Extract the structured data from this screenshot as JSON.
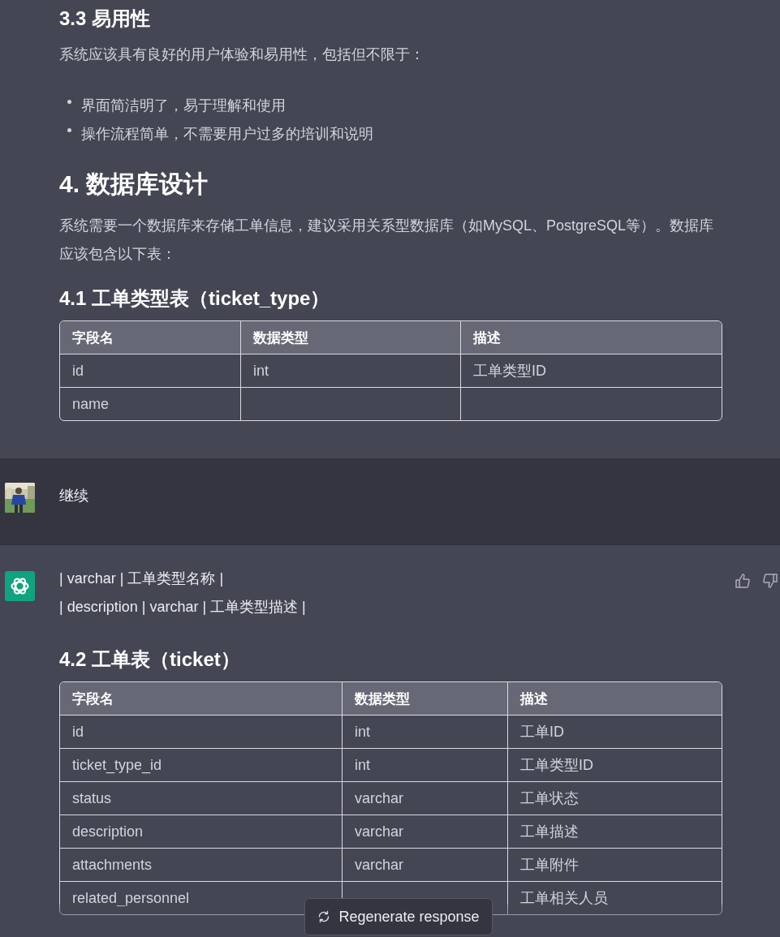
{
  "messages": [
    {
      "kind": "assistant",
      "feedback": false,
      "blocks": [
        {
          "kind": "h3",
          "text": "3.3 易用性"
        },
        {
          "kind": "p",
          "text": "系统应该具有良好的用户体验和易用性，包括但不限于："
        },
        {
          "kind": "ul",
          "items": [
            "界面简洁明了，易于理解和使用",
            "操作流程简单，不需要用户过多的培训和说明"
          ]
        },
        {
          "kind": "h2",
          "text": "4. 数据库设计"
        },
        {
          "kind": "p",
          "text": "系统需要一个数据库来存储工单信息，建议采用关系型数据库（如MySQL、PostgreSQL等）。数据库应该包含以下表："
        },
        {
          "kind": "h3",
          "text": "4.1 工单类型表（ticket_type）"
        },
        {
          "kind": "table",
          "columns": [
            "字段名",
            "数据类型",
            "描述"
          ],
          "rows": [
            [
              "id",
              "int",
              "工单类型ID"
            ],
            [
              "name",
              null,
              null
            ]
          ]
        }
      ]
    },
    {
      "kind": "user",
      "text": "继续"
    },
    {
      "kind": "assistant",
      "feedback": true,
      "blocks": [
        {
          "kind": "lines",
          "items": [
            "| varchar | 工单类型名称 |",
            "| description | varchar | 工单类型描述 |"
          ]
        },
        {
          "kind": "h3",
          "text": "4.2 工单表（ticket）"
        },
        {
          "kind": "table",
          "columns": [
            "字段名",
            "数据类型",
            "描述"
          ],
          "rows": [
            [
              "id",
              "int",
              "工单ID"
            ],
            [
              "ticket_type_id",
              "int",
              "工单类型ID"
            ],
            [
              "status",
              "varchar",
              "工单状态"
            ],
            [
              "description",
              "varchar",
              "工单描述"
            ],
            [
              "attachments",
              "varchar",
              "工单附件"
            ],
            [
              "related_personnel",
              null,
              "工单相关人员"
            ]
          ]
        }
      ]
    }
  ],
  "regenerate_button": {
    "label": "Regenerate response"
  }
}
